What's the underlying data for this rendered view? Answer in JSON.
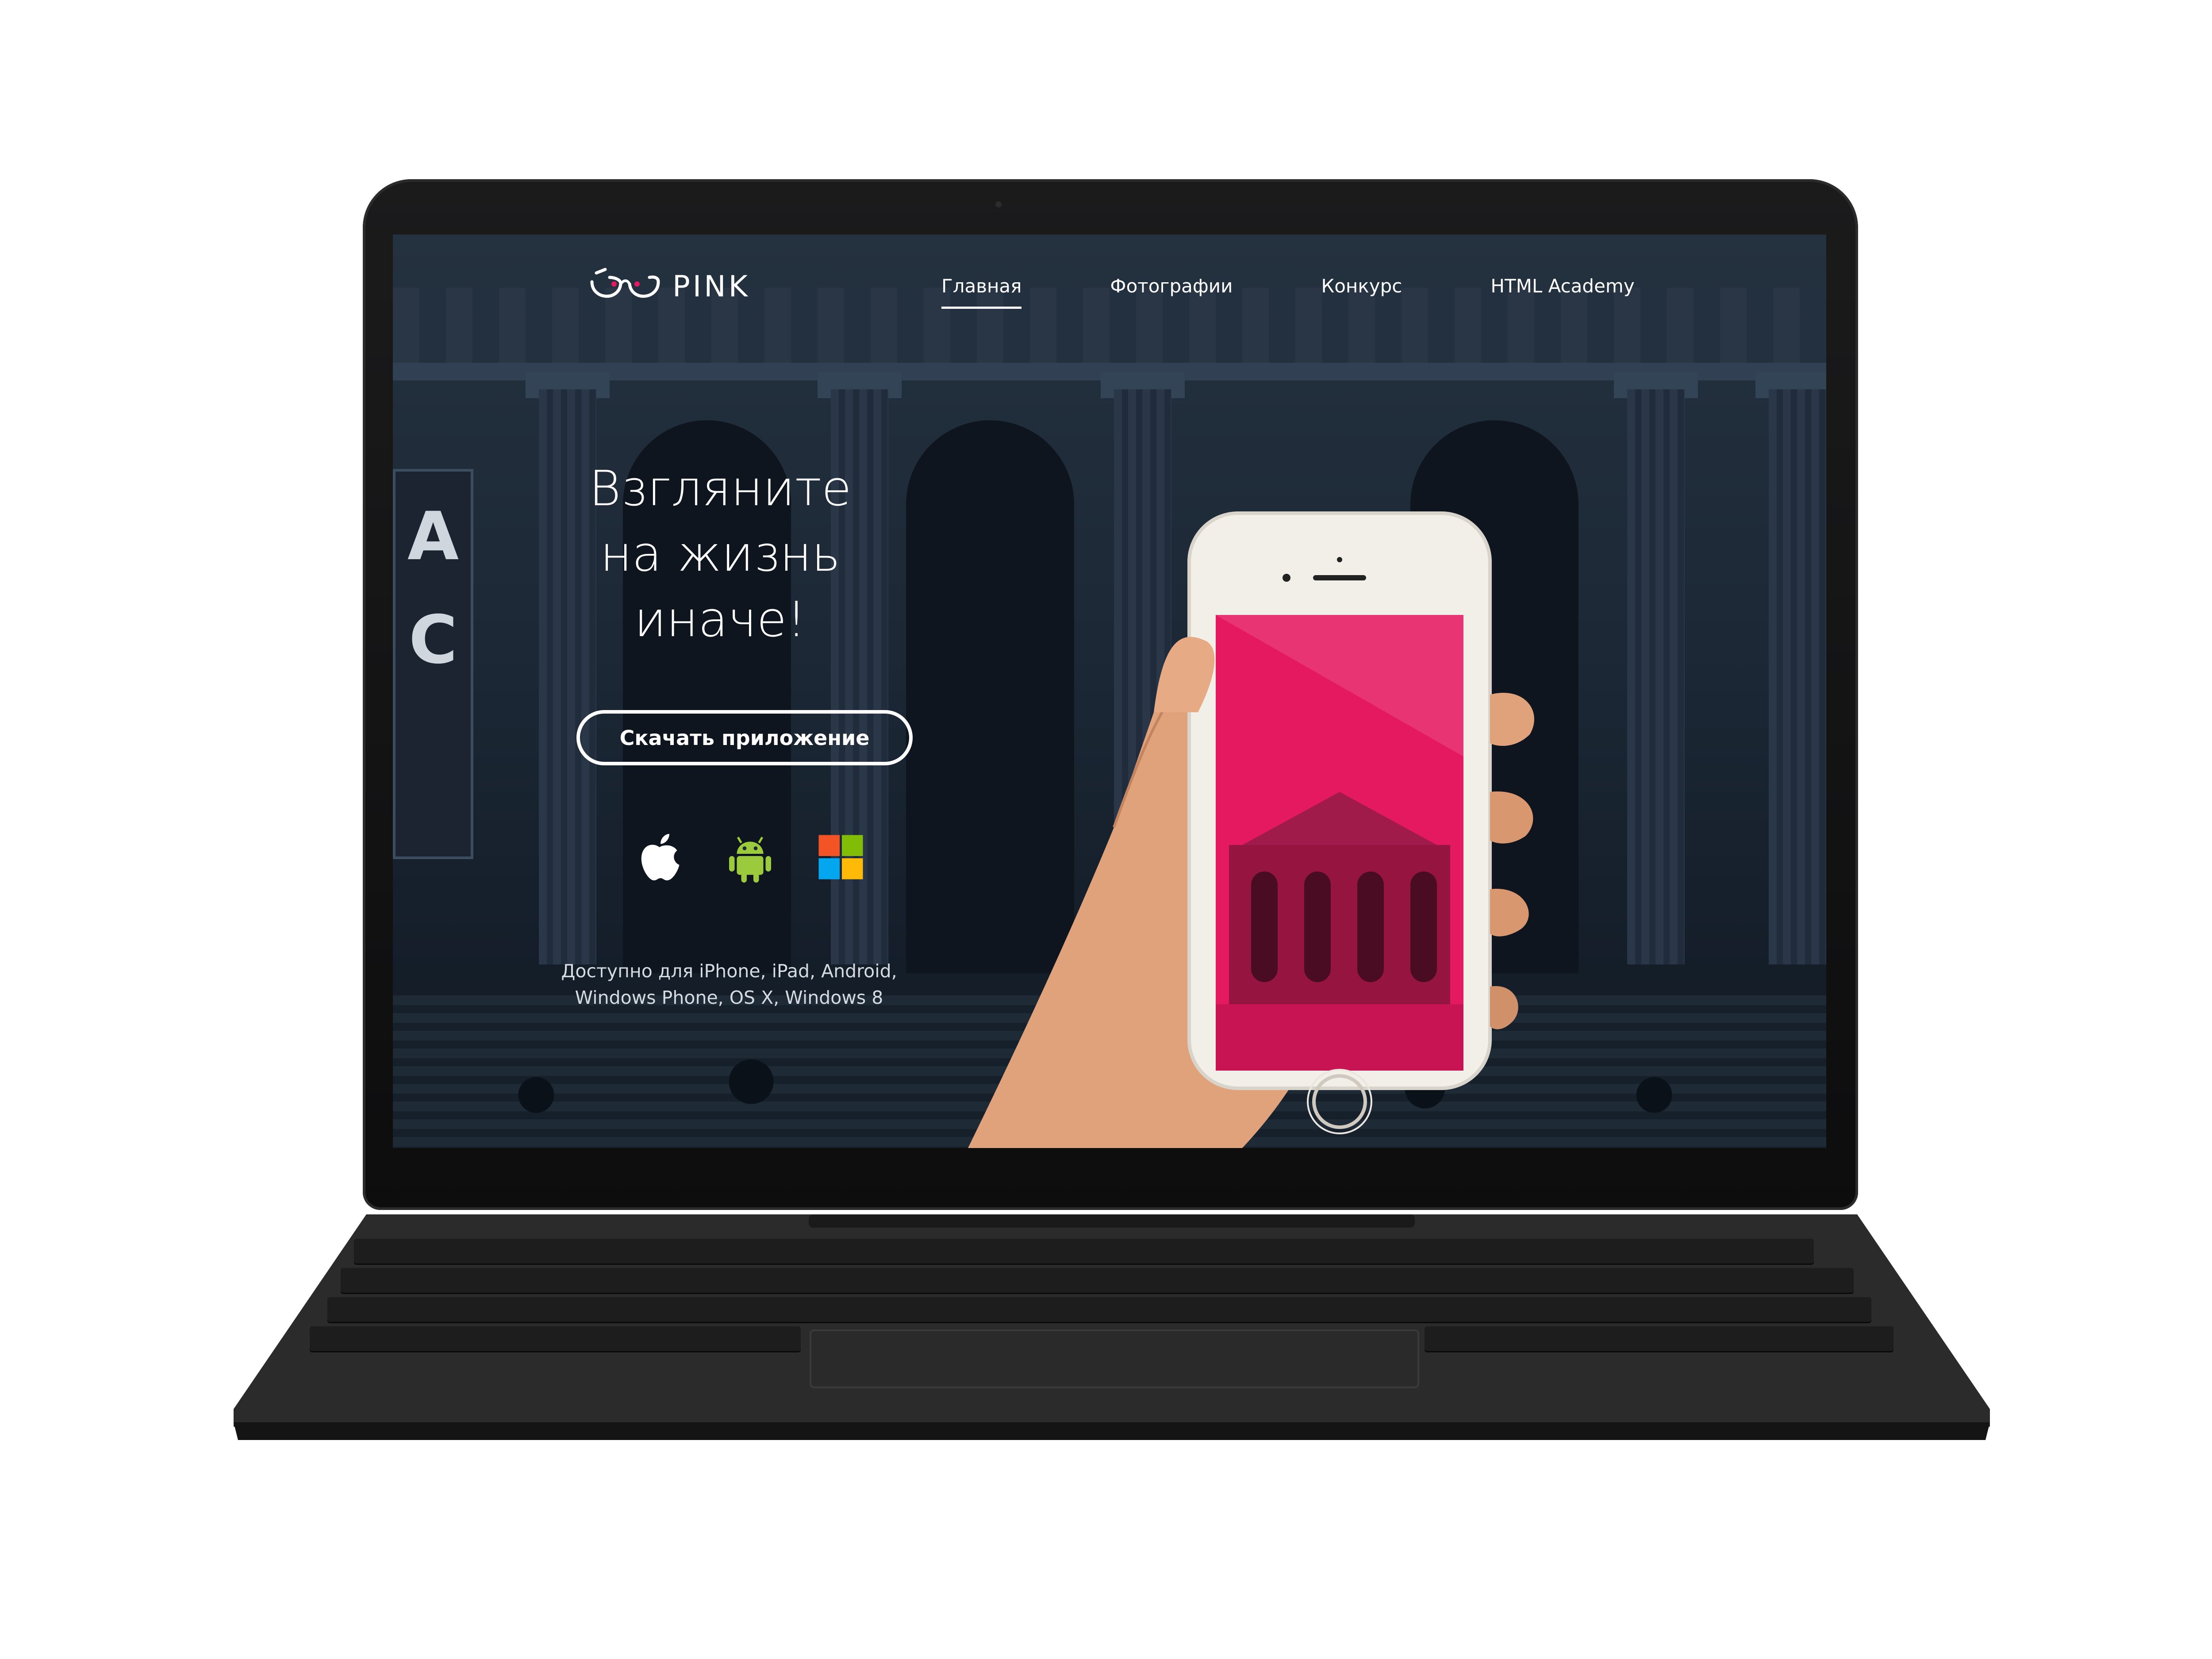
{
  "brand": {
    "name": "PINK"
  },
  "nav": {
    "items": [
      {
        "label": "Главная",
        "active": true
      },
      {
        "label": "Фотографии",
        "active": false
      },
      {
        "label": "Конкурс",
        "active": false
      },
      {
        "label": "HTML Academy",
        "active": false
      }
    ]
  },
  "hero": {
    "title_lines": [
      "Взгляните",
      "на жизнь",
      "иначе!"
    ],
    "download_label": "Скачать приложение",
    "platforms": [
      "apple-icon",
      "android-icon",
      "windows-icon"
    ],
    "availability_lines": [
      "Доступно для iPhone, iPad, Android,",
      "Windows Phone, OS X, Windows 8"
    ]
  },
  "colors": {
    "accent": "#e5195f",
    "background": "#1c2836",
    "text": "#ffffff"
  }
}
